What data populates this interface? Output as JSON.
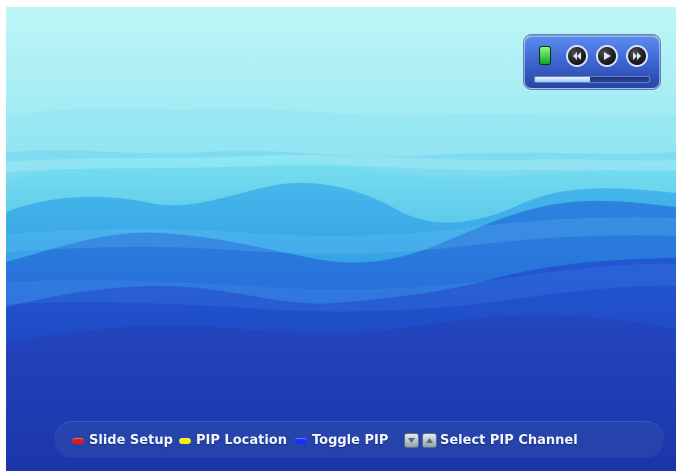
{
  "player": {
    "progress_percent": 48,
    "icons": [
      "status-icon",
      "rewind-icon",
      "play-icon",
      "fast-forward-icon"
    ]
  },
  "footer": {
    "red_label": "Slide Setup",
    "yellow_label": "PIP Location",
    "blue_label": "Toggle PIP",
    "arrow_label": "Select PIP Channel"
  },
  "colors": {
    "red_key": "#e21717",
    "yellow_key": "#f0f000",
    "blue_key": "#1230ff",
    "player_frame": "#3f68d3"
  }
}
